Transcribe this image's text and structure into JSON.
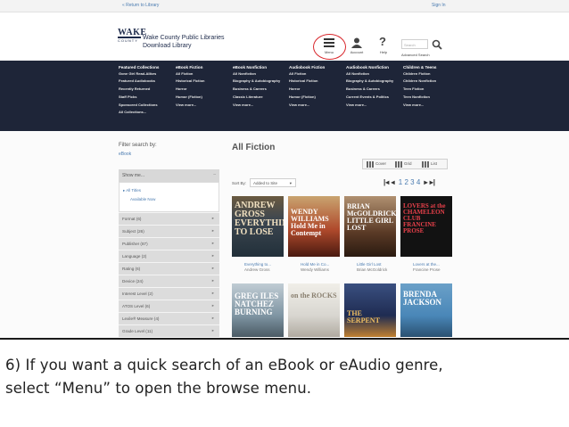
{
  "topbar": {
    "return_label": "« Return to Library",
    "signin_label": "Sign In"
  },
  "header": {
    "logo_word": "WAKE",
    "logo_sub": "COUNTY",
    "library_name_line1": "Wake County Public Libraries",
    "library_name_line2": "Download Library",
    "menu_label": "Menu",
    "account_label": "Account",
    "help_label": "Help",
    "search_placeholder": "Search",
    "advanced_search_label": "Advanced Search",
    "highlight_color": "#d8262b"
  },
  "nav": {
    "columns": [
      {
        "items": [
          "Featured Collections",
          "Gone Girl Read-Alikes",
          "Featured Audiobooks",
          "Recently Returned",
          "Staff Picks",
          "Sponsored Collections",
          "All Collections..."
        ]
      },
      {
        "items": [
          "eBook Fiction",
          "All Fiction",
          "Historical Fiction",
          "Horror",
          "Humor (Fiction)",
          "View more..."
        ]
      },
      {
        "items": [
          "eBook Nonfiction",
          "All Nonfiction",
          "Biography & Autobiography",
          "Business & Careers",
          "Classic Literature",
          "View more..."
        ]
      },
      {
        "items": [
          "Audiobook Fiction",
          "All Fiction",
          "Historical Fiction",
          "Horror",
          "Humor (Fiction)",
          "View more..."
        ]
      },
      {
        "items": [
          "Audiobook Nonfiction",
          "All Nonfiction",
          "Biography & Autobiography",
          "Business & Careers",
          "Current Events & Politics",
          "View more..."
        ]
      },
      {
        "items": [
          "Children & Teens",
          "Children Fiction",
          "Children Nonfiction",
          "Teen Fiction",
          "Teen Nonfiction",
          "View more..."
        ]
      }
    ]
  },
  "sidebar": {
    "filter_title": "Filter search by:",
    "filter_value": "eBook",
    "show_me": "Show me...",
    "option_all": "▸ All Titles",
    "option_available": "Available Now",
    "facets": [
      "Format (6)",
      "Subject (26)",
      "Publisher (87)",
      "Language (2)",
      "Rating (6)",
      "Device (24)",
      "Interest Level (2)",
      "ATOS Level (6)",
      "Lexile® Measure (4)",
      "Grade Level (11)"
    ]
  },
  "main": {
    "title": "All Fiction",
    "view_cover": "Cover",
    "view_grid": "Grid",
    "view_list": "List",
    "sort_label": "Sort By:",
    "sort_value": "Added to Site",
    "pages": [
      "1",
      "2",
      "3",
      "4"
    ],
    "books": [
      {
        "cover_text": "ANDREW GROSS EVERYTHING TO LOSE",
        "title": "Everything to...",
        "author": "Andrew Gross",
        "color": "#3c4650"
      },
      {
        "cover_text": "WENDY WILLIAMS Hold Me in Contempt",
        "title": "Hold Me in Co...",
        "author": "Wendy Williams",
        "color": "#b04a2c"
      },
      {
        "cover_text": "BRIAN McGOLDRICK LITTLE GIRL LOST",
        "title": "Little Girl Lost",
        "author": "Brian McGoldrick",
        "color": "#5a3a26"
      },
      {
        "cover_text": "LOVERS at the CHAMELEON CLUB FRANCINE PROSE",
        "title": "Lovers at the...",
        "author": "Francine Prose",
        "color": "#121212"
      },
      {
        "cover_text": "GREG ILES NATCHEZ BURNING",
        "title": "",
        "author": "",
        "color": "#7f95a3"
      },
      {
        "cover_text": "on the ROCKS",
        "title": "",
        "author": "",
        "color": "#d8d6d0"
      },
      {
        "cover_text": "THE SERPENT",
        "title": "",
        "author": "",
        "color": "#1f2c52"
      },
      {
        "cover_text": "BRENDA JACKSON",
        "title": "",
        "author": "",
        "color": "#4a87b8"
      }
    ]
  },
  "caption": {
    "line1": "6) If you want a quick search of an eBook or eAudio genre,",
    "line2": "select “Menu” to open the browse menu."
  }
}
